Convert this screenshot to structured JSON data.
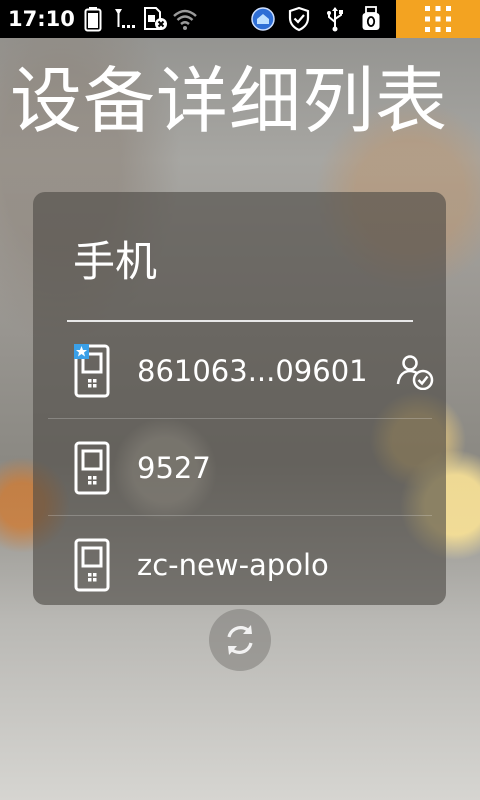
{
  "status_bar": {
    "time": "17:10",
    "background": "#000000",
    "menu_corner_color": "#f3a321",
    "left_icons": [
      "battery-icon",
      "signal-icon",
      "sim-error-icon",
      "wifi-icon"
    ],
    "right_icons": [
      "app-notification-icon",
      "shield-icon",
      "usb-icon",
      "usb-storage-icon"
    ]
  },
  "page": {
    "title": "设备详细列表"
  },
  "device_card": {
    "section_title": "手机",
    "devices": [
      {
        "name": "861063...09601",
        "icon": "phone-icon",
        "starred": true,
        "verified": true
      },
      {
        "name": "9527",
        "icon": "phone-icon",
        "starred": false,
        "verified": false
      },
      {
        "name": "zc-new-apolo",
        "icon": "phone-icon",
        "starred": false,
        "verified": false
      }
    ],
    "star_color": "#3aa0e8"
  },
  "actions": {
    "refresh_icon": "refresh-icon"
  }
}
